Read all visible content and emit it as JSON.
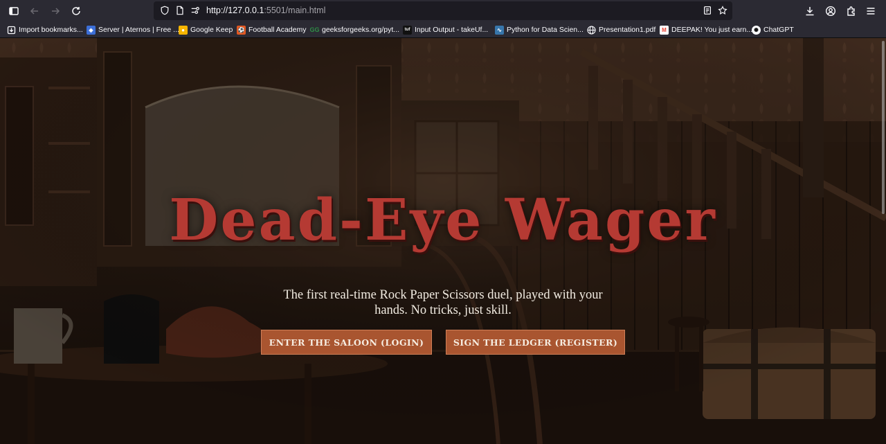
{
  "browser": {
    "url_host": "http://127.0.0.1",
    "url_rest": ":5501/main.html",
    "bookmarks": [
      {
        "label": "Import bookmarks...",
        "icon": "import-icon",
        "color": "#e8e8ea"
      },
      {
        "label": "Server | Aternos | Free ...",
        "icon": "aternos-icon",
        "color": "#3c6fd8"
      },
      {
        "label": "Google Keep",
        "icon": "google-keep-icon",
        "color": "#f7b500"
      },
      {
        "label": "Football Academy",
        "icon": "football-academy-icon",
        "color": "#e25822"
      },
      {
        "label": "geeksforgeeks.org/pyt...",
        "icon": "geeksforgeeks-icon",
        "color": "#2f8d46"
      },
      {
        "label": "Input Output - takeUf...",
        "icon": "takeuforward-icon",
        "color": "#222222"
      },
      {
        "label": "Python for Data Scien...",
        "icon": "python-icon",
        "color": "#3776ab"
      },
      {
        "label": "Presentation1.pdf",
        "icon": "globe-icon",
        "color": "#e8e8ea"
      },
      {
        "label": "DEEPAK! You just earn...",
        "icon": "gmail-icon",
        "color": "#ffffff"
      },
      {
        "label": "ChatGPT",
        "icon": "chatgpt-icon",
        "color": "#e8e8ea"
      }
    ]
  },
  "hero": {
    "title": "Dead-Eye Wager",
    "subtitle": "The first real-time Rock Paper Scissors duel, played with your hands. No tricks, just skill.",
    "login_label": "ENTER THE SALOON (LOGIN)",
    "register_label": "SIGN THE LEDGER (REGISTER)"
  },
  "colors": {
    "accent_button": "#a95530",
    "title_red": "#b53a33",
    "chrome_bg": "#2b2a33"
  }
}
